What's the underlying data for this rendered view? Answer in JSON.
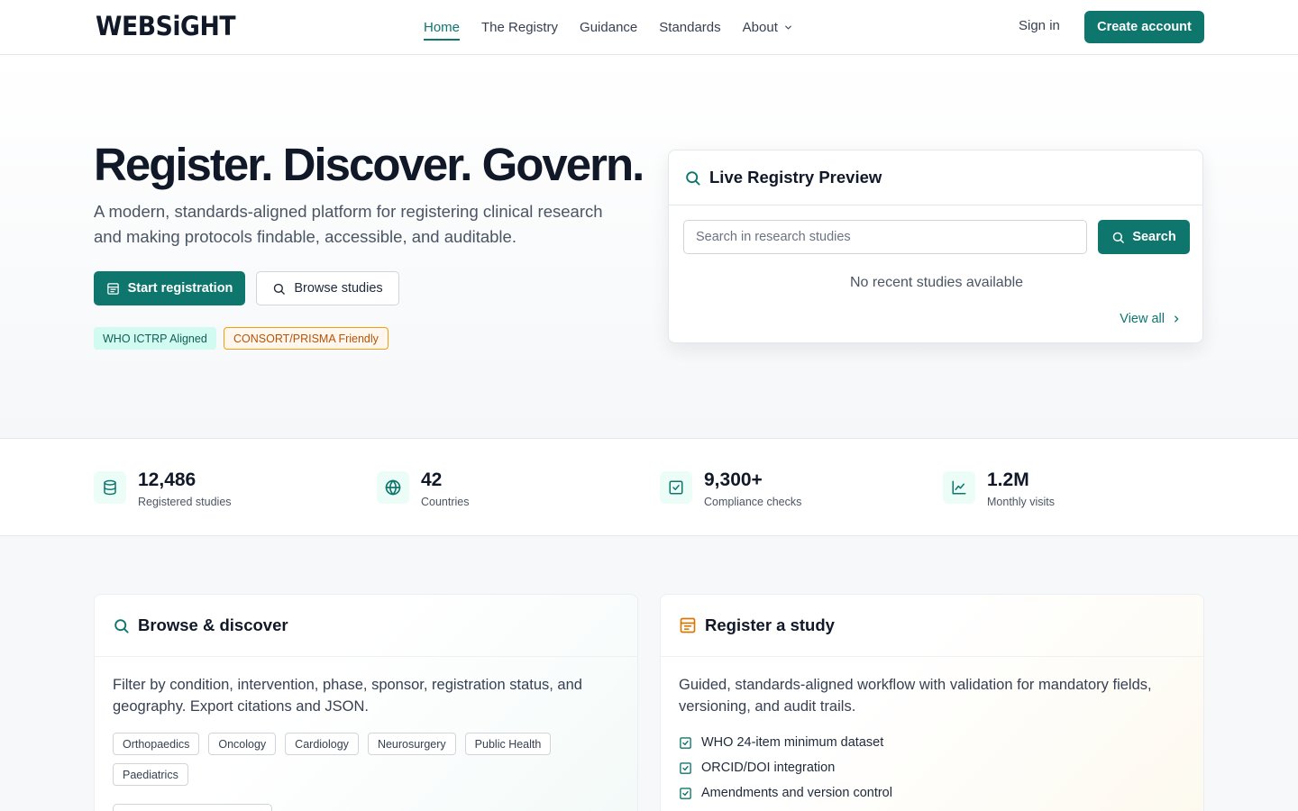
{
  "header": {
    "logo": "WEBSiGHT",
    "nav": [
      {
        "label": "Home"
      },
      {
        "label": "The Registry"
      },
      {
        "label": "Guidance"
      },
      {
        "label": "Standards"
      },
      {
        "label": "About"
      }
    ],
    "sign_in": "Sign in",
    "create_account": "Create account"
  },
  "hero": {
    "title": "Register. Discover. Govern.",
    "subtitle": "A modern, standards-aligned platform for registering clinical research and making protocols findable, accessible, and auditable.",
    "primary_button": "Start registration",
    "secondary_button": "Browse studies",
    "badges": [
      "WHO ICTRP Aligned",
      "CONSORT/PRISMA Friendly"
    ]
  },
  "preview": {
    "title": "Live Registry Preview",
    "search_placeholder": "Search in research studies",
    "search_button": "Search",
    "empty_message": "No recent studies available",
    "view_all": "View all"
  },
  "stats": [
    {
      "value": "12,486",
      "label": "Registered studies",
      "icon": "database-icon"
    },
    {
      "value": "42",
      "label": "Countries",
      "icon": "globe-icon"
    },
    {
      "value": "9,300+",
      "label": "Compliance checks",
      "icon": "check-square-icon"
    },
    {
      "value": "1.2M",
      "label": "Monthly visits",
      "icon": "line-chart-icon"
    }
  ],
  "browse": {
    "title": "Browse & discover",
    "text": "Filter by condition, intervention, phase, sponsor, registration status, and geography. Export citations and JSON.",
    "tags": [
      "Orthopaedics",
      "Oncology",
      "Cardiology",
      "Neurosurgery",
      "Public Health",
      "Paediatrics"
    ]
  },
  "register": {
    "title": "Register a study",
    "text": "Guided, standards-aligned workflow with validation for mandatory fields, versioning, and audit trails.",
    "checks": [
      "WHO 24-item minimum dataset",
      "ORCID/DOI integration",
      "Amendments and version control"
    ]
  },
  "colors": {
    "primary": "#0f766e",
    "accent_amber": "#d97706"
  }
}
